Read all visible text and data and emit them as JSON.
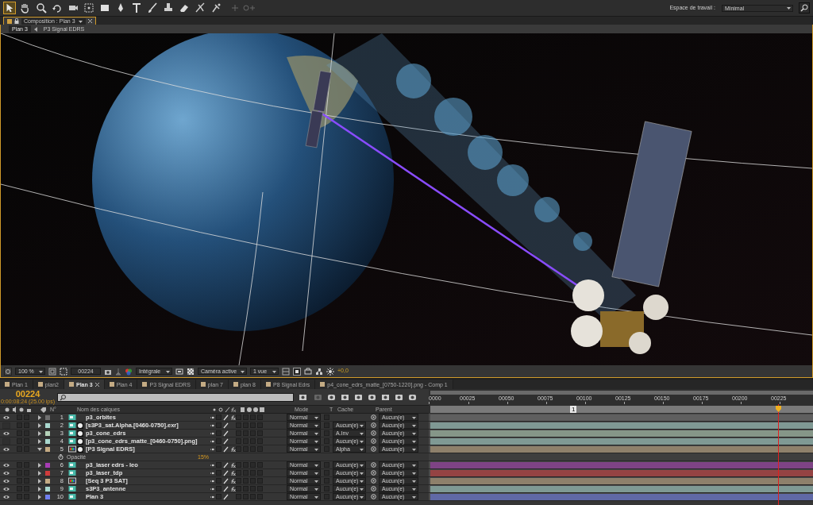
{
  "toolbar": {
    "workspace_label": "Espace de travail :",
    "workspace": "Minimal"
  },
  "composition_panel": {
    "tab": "Composition : Plan 3",
    "breadcrumbs": [
      {
        "label": "Plan 3",
        "selected": true
      },
      {
        "label": "P3 Signal EDRS",
        "selected": false
      }
    ]
  },
  "viewer_controls": {
    "zoom": "100 %",
    "timecode": "00224",
    "resolution": "Intégrale",
    "camera": "Caméra active",
    "views": "1 vue",
    "exposure": "+0,0"
  },
  "timeline_tabs": [
    {
      "label": "Plan 1",
      "selected": false
    },
    {
      "label": "plan2",
      "selected": false
    },
    {
      "label": "Plan 3",
      "selected": true
    },
    {
      "label": "Plan 4",
      "selected": false
    },
    {
      "label": "P3 Signal EDRS",
      "selected": false
    },
    {
      "label": "plan 7",
      "selected": false
    },
    {
      "label": "plan 8",
      "selected": false
    },
    {
      "label": "P8 Signal Edrs",
      "selected": false
    },
    {
      "label": "p4_cone_edrs_matte_[0750-1220].png - Comp 1",
      "selected": false
    }
  ],
  "timeline": {
    "current_frame": "00224",
    "timecode": "0:00:08:24 (25.00 ips)",
    "columns": {
      "number": "N°",
      "name": "Nom des calques",
      "mode": "Mode",
      "t": "T",
      "cache": "Cache",
      "parent": "Parent"
    },
    "ruler": [
      "0000",
      "00025",
      "00050",
      "00075",
      "00100",
      "00125",
      "00150",
      "00175",
      "00200",
      "00225"
    ],
    "work_area_marker": "1",
    "playhead": {
      "level": 0.909
    },
    "layers": [
      {
        "number": "1",
        "name": "p3_orbites",
        "color": "#6e6e6e",
        "visible": true,
        "expanded": false,
        "kind": "footage",
        "matte_icon": false,
        "fx": true,
        "mode": "Normal",
        "parent": "Aucun(e)"
      },
      {
        "number": "2",
        "name": "[s3P3_sat.Alpha.[0460-0750].exr]",
        "color": "#a9d8cf",
        "visible": false,
        "expanded": false,
        "kind": "footage",
        "matte_icon": true,
        "fx": false,
        "mode": "Normal",
        "cache": "Aucun(e)",
        "parent": "Aucun(e)"
      },
      {
        "number": "3",
        "name": "p3_cone_edrs",
        "color": "#b4d2b9",
        "visible": true,
        "expanded": false,
        "kind": "footage",
        "matte_icon": true,
        "fx": false,
        "mode": "Normal",
        "cache": "A.Inv",
        "parent": "Aucun(e)"
      },
      {
        "number": "4",
        "name": "[p3_cone_edrs_matte_[0460-0750].png]",
        "color": "#a9d8cf",
        "visible": false,
        "expanded": false,
        "kind": "footage",
        "matte_icon": true,
        "fx": false,
        "mode": "Normal",
        "cache": "Aucun(e)",
        "parent": "Aucun(e)"
      },
      {
        "number": "5",
        "name": "[P3 Signal EDRS]",
        "color": "#c4ab84",
        "visible": true,
        "expanded": true,
        "kind": "comp",
        "matte_icon": true,
        "fx": true,
        "mode": "Normal",
        "cache": "Alpha",
        "parent": "Aucun(e)",
        "properties": [
          {
            "name": "Opacité",
            "value": "15%"
          }
        ]
      },
      {
        "number": "6",
        "name": "p3_laser edrs - leo",
        "color": "#a63cb4",
        "visible": true,
        "expanded": false,
        "kind": "footage",
        "matte_icon": false,
        "fx": true,
        "mode": "Normal",
        "cache": "Aucun(e)",
        "parent": "Aucun(e)"
      },
      {
        "number": "7",
        "name": "p3_laser_tdp",
        "color": "#d03c3c",
        "visible": true,
        "expanded": false,
        "kind": "footage",
        "matte_icon": false,
        "fx": true,
        "mode": "Normal",
        "cache": "Aucun(e)",
        "parent": "Aucun(e)"
      },
      {
        "number": "8",
        "name": "[Seq 3 P3 SAT]",
        "color": "#c4ab84",
        "visible": true,
        "expanded": false,
        "kind": "comp",
        "matte_icon": false,
        "fx": true,
        "mode": "Normal",
        "cache": "Aucun(e)",
        "parent": "Aucun(e)"
      },
      {
        "number": "9",
        "name": "s3P3_antenne",
        "color": "#a9d8cf",
        "visible": true,
        "expanded": false,
        "kind": "footage",
        "matte_icon": false,
        "fx": true,
        "mode": "Normal",
        "cache": "Aucun(e)",
        "parent": "Aucun(e)"
      },
      {
        "number": "10",
        "name": "Plan 3",
        "color": "#7080f0",
        "visible": true,
        "expanded": false,
        "kind": "footage",
        "matte_icon": false,
        "fx": false,
        "mode": "Normal",
        "cache": "Aucun(e)",
        "parent": "Aucun(e)"
      }
    ]
  }
}
